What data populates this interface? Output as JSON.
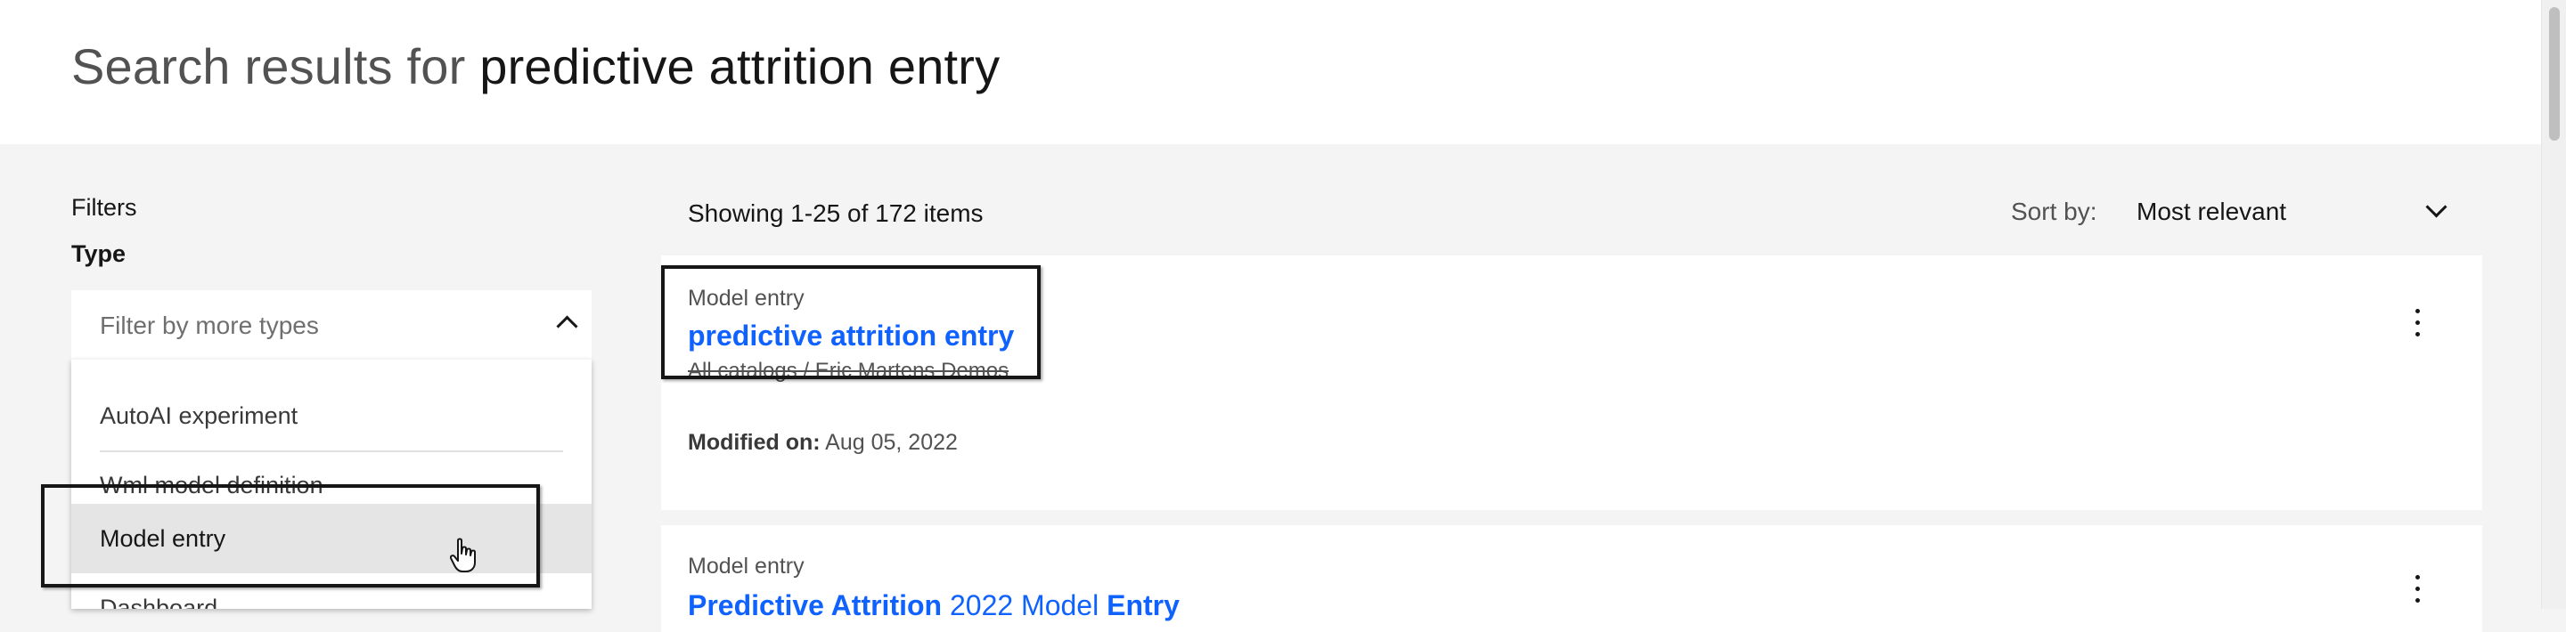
{
  "header": {
    "title_prefix": "Search results for",
    "query": "predictive attrition entry"
  },
  "filters": {
    "heading": "Filters",
    "type_heading": "Type",
    "dropdown_placeholder": "Filter by more types",
    "items": [
      {
        "label": "AutoAI experiment"
      },
      {
        "label": "Wml model definition"
      },
      {
        "label": "Model entry",
        "selected": true
      },
      {
        "label": "Dashboard"
      }
    ]
  },
  "results": {
    "count_text": "Showing 1-25 of 172 items",
    "sort_label": "Sort by:",
    "sort_value": "Most relevant",
    "cards": [
      {
        "type": "Model entry",
        "title": "predictive attrition entry",
        "path": "All catalogs / Eric Martens Demos",
        "modified_label": "Modified on:",
        "modified_value": "Aug 05, 2022"
      },
      {
        "type": "Model entry",
        "title_parts": [
          "Predictive Attrition",
          "2022",
          "Model",
          "Entry"
        ]
      }
    ]
  },
  "colors": {
    "link": "#0f62fe",
    "background": "#f4f4f4",
    "selected_row": "#e5e5e5"
  },
  "icons": [
    "chevron-up-icon",
    "chevron-down-icon",
    "overflow-menu-icon",
    "hand-pointer-cursor-icon"
  ]
}
